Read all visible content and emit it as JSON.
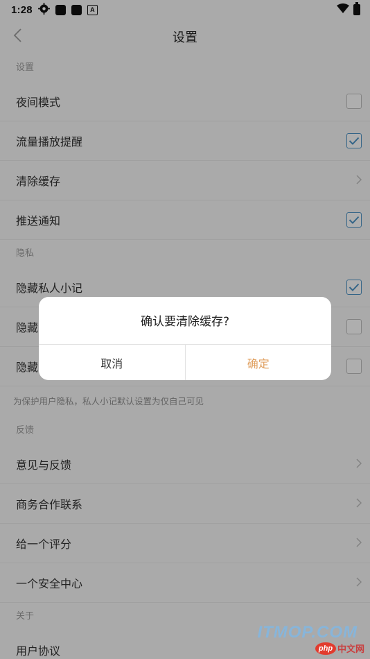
{
  "status_bar": {
    "time": "1:28",
    "icons": [
      "settings-gear-icon",
      "notification-square-icon",
      "notification-square-icon",
      "a-badge-icon"
    ],
    "right_icons": [
      "wifi-icon",
      "battery-icon"
    ]
  },
  "header": {
    "back_icon": "chevron-left-icon",
    "title": "设置"
  },
  "sections": {
    "settings": {
      "title": "设置",
      "items": [
        {
          "label": "夜间模式",
          "control": "checkbox",
          "checked": false
        },
        {
          "label": "流量播放提醒",
          "control": "checkbox",
          "checked": true
        },
        {
          "label": "清除缓存",
          "control": "chevron"
        },
        {
          "label": "推送通知",
          "control": "checkbox",
          "checked": true
        }
      ]
    },
    "privacy": {
      "title": "隐私",
      "items": [
        {
          "label": "隐藏私人小记",
          "control": "checkbox",
          "checked": true
        },
        {
          "label": "隐藏",
          "control": "checkbox",
          "checked": false
        },
        {
          "label": "隐藏",
          "control": "checkbox",
          "checked": false
        }
      ],
      "note": "为保护用户隐私，私人小记默认设置为仅自己可见"
    },
    "feedback": {
      "title": "反馈",
      "items": [
        {
          "label": "意见与反馈",
          "control": "chevron"
        },
        {
          "label": "商务合作联系",
          "control": "chevron"
        },
        {
          "label": "给一个评分",
          "control": "chevron"
        },
        {
          "label": "一个安全中心",
          "control": "chevron"
        }
      ]
    },
    "about": {
      "title": "关于",
      "items": [
        {
          "label": "用户协议",
          "control": "none"
        }
      ]
    }
  },
  "dialog": {
    "message": "确认要清除缓存?",
    "cancel_label": "取消",
    "confirm_label": "确定"
  },
  "watermark": {
    "text": "ITMOP.COM",
    "badge": "php",
    "suffix": "中文网"
  },
  "colors": {
    "background": "#f4f4f4",
    "checkbox_checked": "#4a90c2",
    "confirm_text": "#e0a060",
    "dialog_bg": "#ffffff"
  }
}
